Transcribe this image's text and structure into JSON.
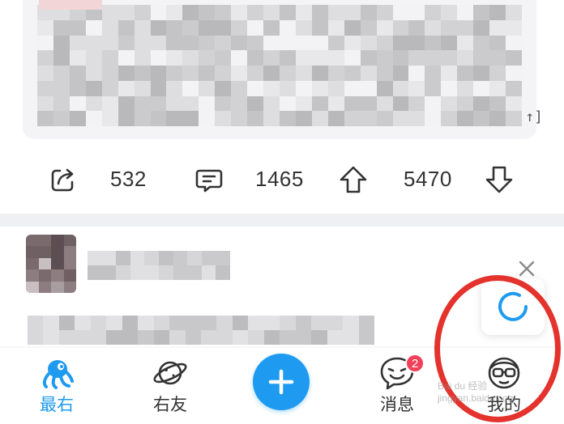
{
  "post1": {
    "actions": {
      "share_count": "532",
      "comment_count": "1465",
      "upvote_count": "5470",
      "corner_text": "↑]"
    }
  },
  "post2": {
    "close_label": "×"
  },
  "nav": {
    "items": [
      {
        "label": "最右",
        "icon": "octopus-icon",
        "active": true
      },
      {
        "label": "右友",
        "icon": "planet-icon",
        "active": false
      },
      {
        "label": "",
        "icon": "plus-icon",
        "active": false
      },
      {
        "label": "消息",
        "icon": "chat-face-icon",
        "active": false
      },
      {
        "label": "我的",
        "icon": "glasses-face-icon",
        "active": false
      }
    ],
    "message_badge": "2"
  },
  "watermark": "Bai du 经验 jingyan.baidu.com",
  "colors": {
    "accent": "#1e9bf0",
    "badge": "#f0415a",
    "annotation_ring": "#e4322d"
  }
}
